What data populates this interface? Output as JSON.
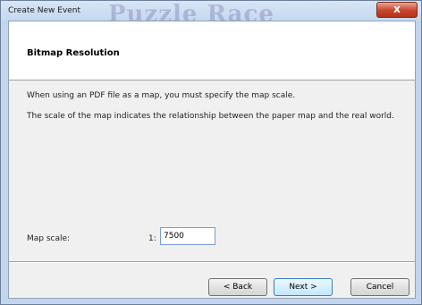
{
  "window": {
    "title": "Create New Event",
    "background_text": "Puzzle Race",
    "close_symbol": "x"
  },
  "header": {
    "title": "Bitmap Resolution"
  },
  "body": {
    "line1": "When using an PDF file as a map, you must specify the map scale.",
    "line2": "The scale of the map indicates the relationship between the paper map and the real world."
  },
  "map_scale": {
    "label": "Map scale:",
    "prefix": "1:",
    "value": "7500"
  },
  "buttons": {
    "back": "< Back",
    "next": "Next >",
    "cancel": "Cancel"
  },
  "colors": {
    "accent": "#3c7fb1",
    "close": "#c7432a"
  }
}
